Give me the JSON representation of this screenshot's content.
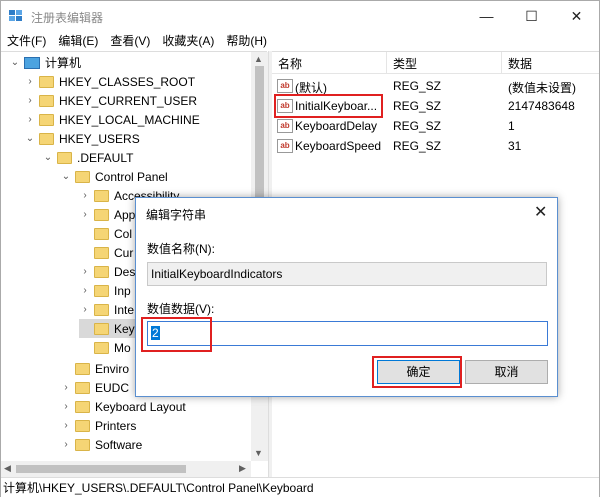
{
  "window": {
    "title": "注册表编辑器",
    "min_glyph": "—",
    "max_glyph": "☐",
    "close_glyph": "✕"
  },
  "menu": [
    "文件(F)",
    "编辑(E)",
    "查看(V)",
    "收藏夹(A)",
    "帮助(H)"
  ],
  "tree": {
    "root": "计算机",
    "items": [
      {
        "label": "HKEY_CLASSES_ROOT",
        "chev": "›"
      },
      {
        "label": "HKEY_CURRENT_USER",
        "chev": "›"
      },
      {
        "label": "HKEY_LOCAL_MACHINE",
        "chev": "›"
      },
      {
        "label": "HKEY_USERS",
        "chev": "⌄"
      },
      {
        "label": ".DEFAULT",
        "chev": "⌄"
      },
      {
        "label": "Control Panel",
        "chev": "⌄"
      },
      {
        "label": "Accessibility",
        "chev": "›"
      },
      {
        "label": "App",
        "chev": "›"
      },
      {
        "label": "Col",
        "chev": ""
      },
      {
        "label": "Cur",
        "chev": ""
      },
      {
        "label": "Des",
        "chev": "›"
      },
      {
        "label": "Inp",
        "chev": "›"
      },
      {
        "label": "Inte",
        "chev": "›"
      },
      {
        "label": "Key",
        "chev": ""
      },
      {
        "label": "Mo",
        "chev": ""
      },
      {
        "label": "Enviro",
        "chev": ""
      },
      {
        "label": "EUDC",
        "chev": "›"
      },
      {
        "label": "Keyboard Layout",
        "chev": "›"
      },
      {
        "label": "Printers",
        "chev": "›"
      },
      {
        "label": "Software",
        "chev": "›"
      }
    ]
  },
  "list": {
    "headers": {
      "name": "名称",
      "type": "类型",
      "data": "数据"
    },
    "rows": [
      {
        "name": "(默认)",
        "type": "REG_SZ",
        "data": "(数值未设置)"
      },
      {
        "name": "InitialKeyboar...",
        "type": "REG_SZ",
        "data": "2147483648"
      },
      {
        "name": "KeyboardDelay",
        "type": "REG_SZ",
        "data": "1"
      },
      {
        "name": "KeyboardSpeed",
        "type": "REG_SZ",
        "data": "31"
      }
    ],
    "icon_text": "ab"
  },
  "status": "计算机\\HKEY_USERS\\.DEFAULT\\Control Panel\\Keyboard",
  "dialog": {
    "title": "编辑字符串",
    "close_glyph": "✕",
    "name_label": "数值名称(N):",
    "name_value": "InitialKeyboardIndicators",
    "data_label": "数值数据(V):",
    "data_value": "2",
    "ok": "确定",
    "cancel": "取消"
  },
  "colors": {
    "highlight_box": "#e02020",
    "selection": "#0078d7",
    "folder": "#f5d575"
  }
}
